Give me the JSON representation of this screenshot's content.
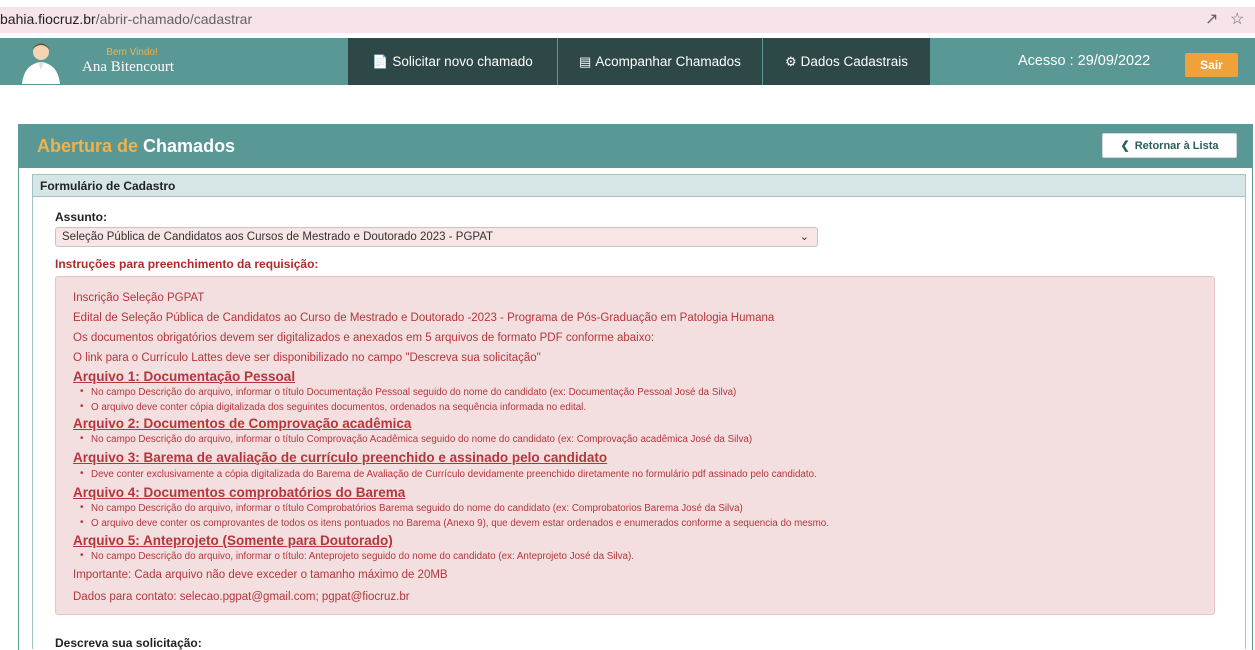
{
  "browser": {
    "url_host": "bahia.fiocruz.br",
    "url_path": "/abrir-chamado/cadastrar",
    "share_icon": "share-icon",
    "bookmark_icon": "star-icon"
  },
  "navbar": {
    "welcome": "Bem Vindo!",
    "user_name": "Ana Bitencourt",
    "buttons": [
      {
        "label": "Solicitar novo chamado",
        "icon": "document-icon"
      },
      {
        "label": "Acompanhar Chamados",
        "icon": "list-icon"
      },
      {
        "label": "Dados Cadastrais",
        "icon": "gear-icon"
      }
    ],
    "access": "Acesso : 29/09/2022",
    "logout": "Sair"
  },
  "panel": {
    "title_part1": "Abertura de",
    "title_part2": "Chamados",
    "back_button": "Retornar à Lista",
    "form_title": "Formulário de Cadastro"
  },
  "form": {
    "subject_label": "Assunto:",
    "subject_value": "Seleção Pública de Candidatos aos Cursos de Mestrado e Doutorado 2023 - PGPAT",
    "instructions_label": "Instruções para preenchimento da requisição:",
    "description_label": "Descreva sua solicitação:"
  },
  "instructions": {
    "intro": [
      "Inscrição Seleção PGPAT",
      "Edital de Seleção Pública de Candidatos ao Curso de Mestrado e Doutorado -2023 - Programa de Pós-Graduação em Patologia Humana",
      "Os documentos obrigatórios devem ser digitalizados e anexados em 5 arquivos de formato PDF conforme abaixo:",
      "O link para o Currículo Lattes deve ser disponibilizado no campo \"Descreva sua solicitação\""
    ],
    "arquivos": [
      {
        "title": "Arquivo 1: Documentação Pessoal",
        "items": [
          "No campo Descrição do arquivo, informar o título Documentação Pessoal seguido do nome do candidato (ex: Documentação Pessoal José da Silva)",
          "O arquivo deve conter cópia digitalizada dos seguintes documentos, ordenados na sequência informada no edital."
        ]
      },
      {
        "title": "Arquivo 2: Documentos de Comprovação acadêmica",
        "items": [
          "No campo Descrição do arquivo, informar o título Comprovação Acadêmica seguido do nome do candidato (ex: Comprovação acadêmica José da Silva)"
        ]
      },
      {
        "title": "Arquivo 3: Barema de avaliação de currículo preenchido e assinado pelo candidato",
        "items": [
          "Deve conter exclusivamente a cópia digitalizada do Barema de Avaliação de Currículo devidamente preenchido diretamente no formulário pdf assinado pelo candidato."
        ]
      },
      {
        "title": "Arquivo 4: Documentos comprobatórios do Barema",
        "items": [
          "No campo Descrição do arquivo, informar o título Comprobatórios Barema seguido do nome do candidato (ex: Comprobatorios Barema José da Silva)",
          "O arquivo deve conter os comprovantes de todos os itens pontuados no Barema (Anexo 9), que devem estar ordenados e enumerados conforme a sequencia do mesmo."
        ]
      },
      {
        "title": "Arquivo 5: Anteprojeto (Somente para Doutorado)",
        "items": [
          "No campo Descrição do arquivo, informar o título: Anteprojeto seguido do nome do candidato (ex: Anteprojeto José da Silva)."
        ]
      }
    ],
    "important": "Importante: Cada arquivo não deve exceder o tamanho máximo de 20MB",
    "contact": "Dados para contato: selecao.pgpat@gmail.com; pgpat@fiocruz.br"
  },
  "colors": {
    "teal": "#5a9896",
    "nav_dark": "#2e4848",
    "accent": "#f0b24b",
    "instruction_text": "#b5363b",
    "instruction_bg": "#f4dfe0"
  }
}
